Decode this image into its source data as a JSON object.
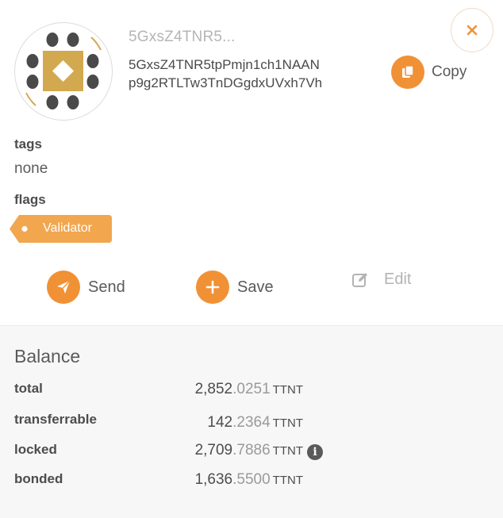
{
  "account": {
    "short_name": "5GxsZ4TNR5...",
    "address": "5GxsZ4TNR5tpPmjn1ch1NAANp9g2RTLTw3TnDGgdxUVxh7Vh"
  },
  "header": {
    "copy_label": "Copy",
    "close_icon": "close-icon",
    "copy_icon": "copy-icon"
  },
  "details": {
    "tags_label": "tags",
    "tags_value": "none",
    "flags_label": "flags",
    "flags": [
      "Validator"
    ]
  },
  "actions": {
    "send_label": "Send",
    "save_label": "Save",
    "edit_label": "Edit"
  },
  "balance": {
    "title": "Balance",
    "rows": [
      {
        "key": "total",
        "int": "2,852",
        "dec": ".0251",
        "unit": "TTNT"
      },
      {
        "key": "transferrable",
        "int": "142",
        "dec": ".2364",
        "unit": "TTNT"
      },
      {
        "key": "locked",
        "int": "2,709",
        "dec": ".7886",
        "unit": "TTNT",
        "info": "i"
      },
      {
        "key": "bonded",
        "int": "1,636",
        "dec": ".5500",
        "unit": "TTNT"
      }
    ]
  },
  "colors": {
    "accent": "#f19135",
    "tag": "#f2a64e",
    "identicon_dark": "#4a4a4a",
    "identicon_gold": "#d3a950"
  }
}
